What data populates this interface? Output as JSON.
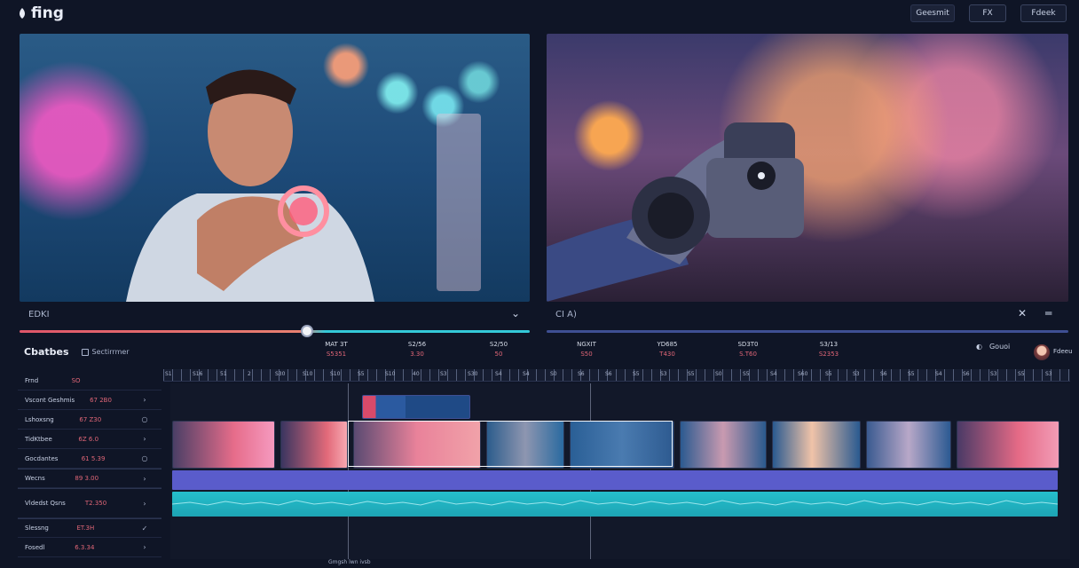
{
  "app": {
    "logo_text": "fing"
  },
  "topbar": {
    "buttons": [
      "Geesmit",
      "FX",
      "Fdeek"
    ]
  },
  "previews": {
    "left_label": "EDKI",
    "right_label": "CI A)"
  },
  "panel": {
    "title": "Cbatbes",
    "subtitle": "Sectirrmer"
  },
  "stats": [
    {
      "a": "MAT 3T",
      "b": "S5351"
    },
    {
      "a": "S2/56",
      "b": "3.30"
    },
    {
      "a": "S2/50",
      "b": "50"
    },
    {
      "a": "NGXIT",
      "b": "S50"
    },
    {
      "a": "YD685",
      "b": "T430"
    },
    {
      "a": "SD3T0",
      "b": "S.T60"
    },
    {
      "a": "S3/13",
      "b": "S2353"
    }
  ],
  "right_tools": {
    "label": "Gouoi",
    "user": "Fdeeu"
  },
  "ruler_ticks": [
    "S1",
    "S16",
    "51",
    "2",
    "S30",
    "S10",
    "S10",
    "S5",
    "S10",
    "40",
    "S3",
    "S30",
    "S4",
    "S4",
    "S0",
    "S6",
    "S6",
    "S5",
    "S3",
    "S5",
    "S0",
    "S5",
    "S4",
    "S60",
    "S5",
    "S3",
    "S6",
    "S5",
    "S4",
    "S6",
    "S3",
    "S5",
    "S3"
  ],
  "tracks": [
    {
      "name": "Frnd",
      "value": "SO",
      "mark": ""
    },
    {
      "name": "Vscont Geshmis",
      "value": "67 2B0",
      "mark": "›"
    },
    {
      "name": "Lshoxsng",
      "value": "67 Z30",
      "mark": "○"
    },
    {
      "name": "TidKtbee",
      "value": "6Z 6.0",
      "mark": "›"
    },
    {
      "name": "Gocdantes",
      "value": "61 5.39",
      "mark": "○"
    },
    {
      "name": "Wecns",
      "value": "89 3.00",
      "mark": "›"
    },
    {
      "name": "Vldedst Qsns",
      "value": "T2.350",
      "mark": "›"
    },
    {
      "name": "Slessng",
      "value": "ET.3H",
      "mark": "✓"
    },
    {
      "name": "Fosedl",
      "value": "6.3.34",
      "mark": "›"
    }
  ],
  "bottom_label": "Gmgsh lwn ivsb",
  "colors": {
    "background": "#0f1526",
    "accent_red": "#e06677",
    "accent_cyan": "#34c9d8",
    "track_purple": "#5a5ccb"
  }
}
